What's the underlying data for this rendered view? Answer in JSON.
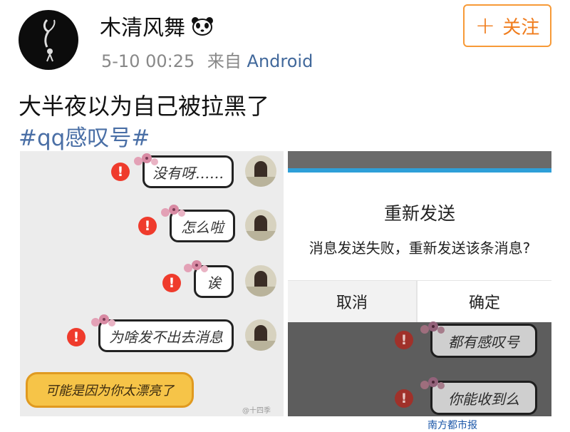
{
  "post": {
    "username": "木清风舞",
    "time": "5-10 00:25",
    "from_label": "来自",
    "source": "Android",
    "follow_label": "关注",
    "follow_plus": "+",
    "text": "大半夜以为自己被拉黑了",
    "hashtag": "#qq感叹号#"
  },
  "left_image": {
    "messages": [
      "没有呀……",
      "怎么啦",
      "诶",
      "为啥发不出去消息"
    ],
    "error_mark": "!",
    "sticker_text": "可能是因为你太漂亮了",
    "watermark": "@十四季"
  },
  "right_image": {
    "dialog_title": "重新发送",
    "dialog_message": "消息发送失败，重新发送该条消息?",
    "cancel_label": "取消",
    "confirm_label": "确定",
    "messages": [
      "都有感叹号",
      "你能收到么"
    ],
    "error_mark": "!"
  },
  "watermark_bottom": "南方都市报",
  "colors": {
    "accent": "#f07c1c",
    "link": "#4a6fa6",
    "error": "#ef3b2c"
  },
  "icons": [
    "avatar",
    "panda-icon",
    "plus-icon",
    "error-icon",
    "flower-icon"
  ]
}
